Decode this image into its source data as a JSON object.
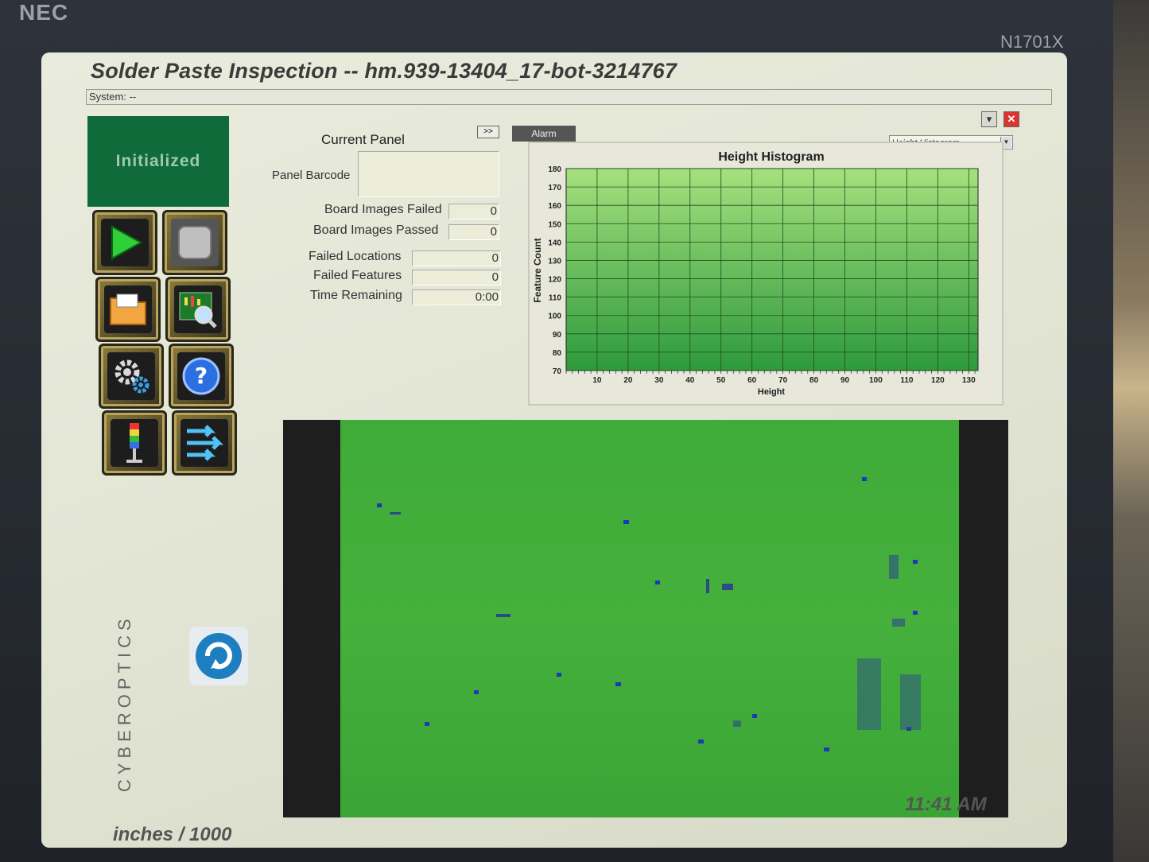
{
  "monitor": {
    "brand": "NEC",
    "model": "N1701X"
  },
  "window": {
    "title": "Solder Paste Inspection -- hm.939-13404_17-bot-3214767",
    "system_text": "System: --",
    "minimize_icon": "minimize-icon",
    "close_icon": "close-icon"
  },
  "status": {
    "text": "Initialized",
    "color": "#0f6b3a"
  },
  "toolbar": {
    "buttons": [
      {
        "name": "run-button",
        "icon": "play-icon"
      },
      {
        "name": "stop-button",
        "icon": "stop-icon"
      },
      {
        "name": "open-button",
        "icon": "folder-icon"
      },
      {
        "name": "inspect-view-button",
        "icon": "magnifier-board-icon"
      },
      {
        "name": "settings-button",
        "icon": "gears-icon"
      },
      {
        "name": "help-button",
        "icon": "help-icon"
      },
      {
        "name": "light-tower-button",
        "icon": "light-tower-icon"
      },
      {
        "name": "transfer-button",
        "icon": "arrows-right-icon"
      }
    ]
  },
  "current_panel": {
    "heading": "Current Panel",
    "expand_label": ">>",
    "barcode_label": "Panel Barcode",
    "barcode_value": "",
    "stats": [
      {
        "label": "Board Images Failed",
        "value": "0"
      },
      {
        "label": "Board Images Passed",
        "value": "0"
      },
      {
        "label": "Failed Locations",
        "value": "0"
      },
      {
        "label": "Failed Features",
        "value": "0"
      },
      {
        "label": "Time Remaining",
        "value": "0:00"
      }
    ]
  },
  "alarm_tab": "Alarm",
  "chart_selector": {
    "selected": "Height Histogram"
  },
  "chart_data": {
    "type": "bar",
    "title": "Height Histogram",
    "xlabel": "Height",
    "ylabel": "Feature Count",
    "x_ticks": [
      10,
      20,
      30,
      40,
      50,
      60,
      70,
      80,
      90,
      100,
      110,
      120,
      130
    ],
    "y_ticks": [
      70,
      80,
      90,
      100,
      110,
      120,
      130,
      140,
      150,
      160,
      170,
      180
    ],
    "xlim": [
      0,
      133
    ],
    "ylim": [
      70,
      180
    ],
    "values": [],
    "grid": true,
    "colors": {
      "top": "#a6e07e",
      "bottom": "#2d9a3c"
    }
  },
  "board_view": {
    "background": "#3fab38",
    "pad_color": "#1a3bb5"
  },
  "branding": {
    "logo_text": "CYBEROPTICS",
    "refresh_icon": "refresh-icon"
  },
  "footer": {
    "units": "inches / 1000",
    "clock": "11:41 AM"
  }
}
